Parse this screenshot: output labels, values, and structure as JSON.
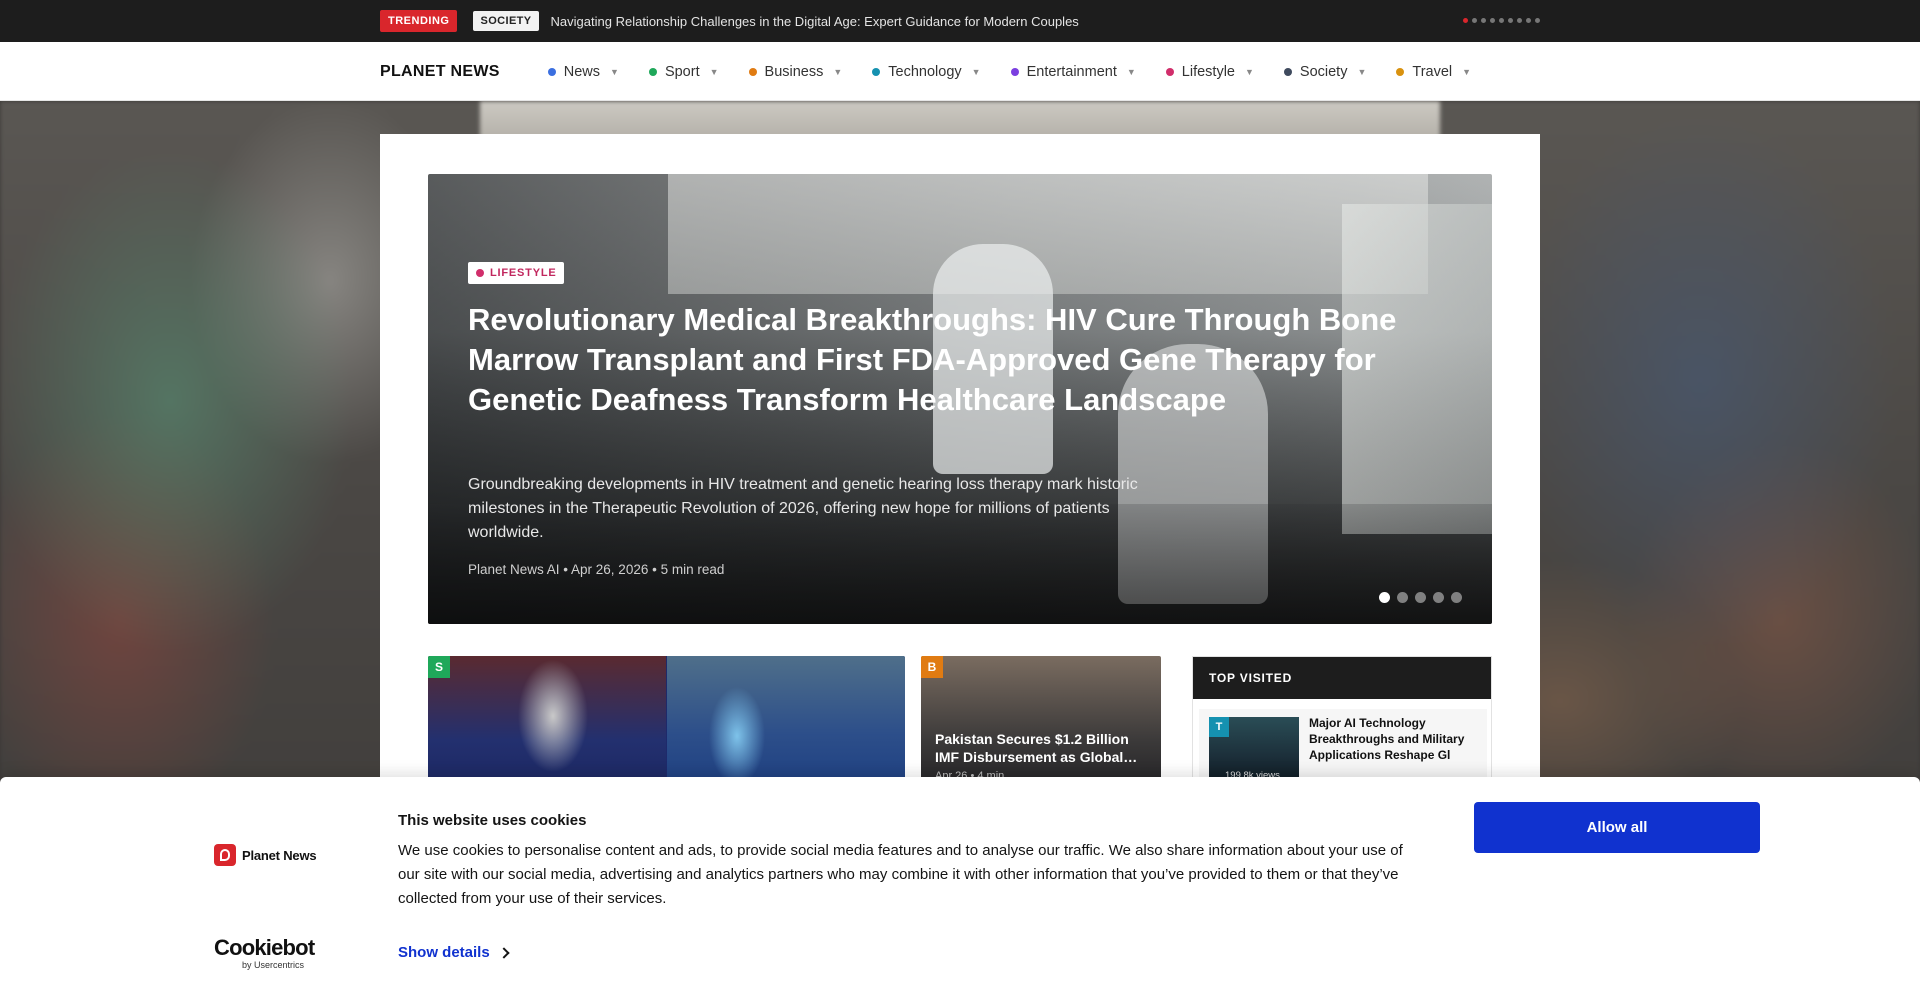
{
  "trending": {
    "label": "TRENDING",
    "section": "SOCIETY",
    "headline": "Navigating Relationship Challenges in the Digital Age: Expert Guidance for Modern Couples",
    "ticker_count": 9,
    "ticker_active": 0
  },
  "nav": {
    "brand": "PLANET NEWS",
    "items": [
      {
        "label": "News",
        "color": "#3b6fe0"
      },
      {
        "label": "Sport",
        "color": "#1fa85a"
      },
      {
        "label": "Business",
        "color": "#e07b12"
      },
      {
        "label": "Technology",
        "color": "#1591b0"
      },
      {
        "label": "Entertainment",
        "color": "#7b3fe0"
      },
      {
        "label": "Lifestyle",
        "color": "#d12e6b"
      },
      {
        "label": "Society",
        "color": "#3f4a5e"
      },
      {
        "label": "Travel",
        "color": "#d9920f"
      }
    ],
    "caret": "▼"
  },
  "hero": {
    "tag": "LIFESTYLE",
    "title": "Revolutionary Medical Breakthroughs: HIV Cure Through Bone Marrow Transplant and First FDA-Approved Gene Therapy for Genetic Deafness Transform Healthcare Landscape",
    "summary": "Groundbreaking developments in HIV treatment and genetic hearing loss therapy mark historic milestones in the Therapeutic Revolution of 2026, offering new hope for millions of patients worldwide.",
    "meta": "Planet News AI • Apr 26, 2026 • 5 min read",
    "slide_count": 5,
    "slide_active": 0
  },
  "stories": {
    "sport": {
      "chip": "S",
      "chip_color": "#1fa85a"
    },
    "business": {
      "chip": "B",
      "chip_color": "#e07b12",
      "title": "Pakistan Secures $1.2 Billion IMF Disbursement as Global…",
      "meta": "Apr 26 • 4 min"
    }
  },
  "top_visited": {
    "heading": "TOP VISITED",
    "items": [
      {
        "chip": "T",
        "title": "Major AI Technology Breakthroughs and Military Applications Reshape Gl",
        "views": "199.8k views"
      }
    ]
  },
  "cookie": {
    "logo_text": "Planet News",
    "heading": "This website uses cookies",
    "body": "We use cookies to personalise content and ads, to provide social media features and to analyse our traffic. We also share information about your use of our site with our social media, advertising and analytics partners who may combine it with other information that you’ve provided to them or that they’ve collected from your use of their services.",
    "show_details": "Show details",
    "allow_all": "Allow all",
    "cookiebot_name": "Cookiebot",
    "cookiebot_by": "by Usercentrics"
  },
  "colors": {
    "brand_red": "#d9262c",
    "cookie_blue": "#1032cf",
    "lifestyle": "#d12e6b"
  }
}
